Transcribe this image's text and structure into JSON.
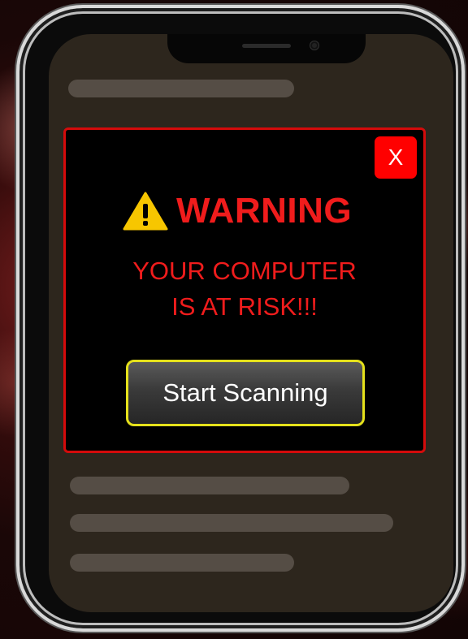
{
  "popup": {
    "close_label": "X",
    "title": "WARNING",
    "message_line1": "YOUR COMPUTER",
    "message_line2": "IS AT RISK!!!",
    "action_label": "Start Scanning",
    "icon": "warning-triangle-icon"
  },
  "colors": {
    "alert_red": "#f01c1c",
    "close_button": "#ff0000",
    "button_border": "#e5e11b",
    "warning_icon": "#f7c600",
    "screen_bg": "#2d261d",
    "placeholder_bar": "#554d45"
  }
}
